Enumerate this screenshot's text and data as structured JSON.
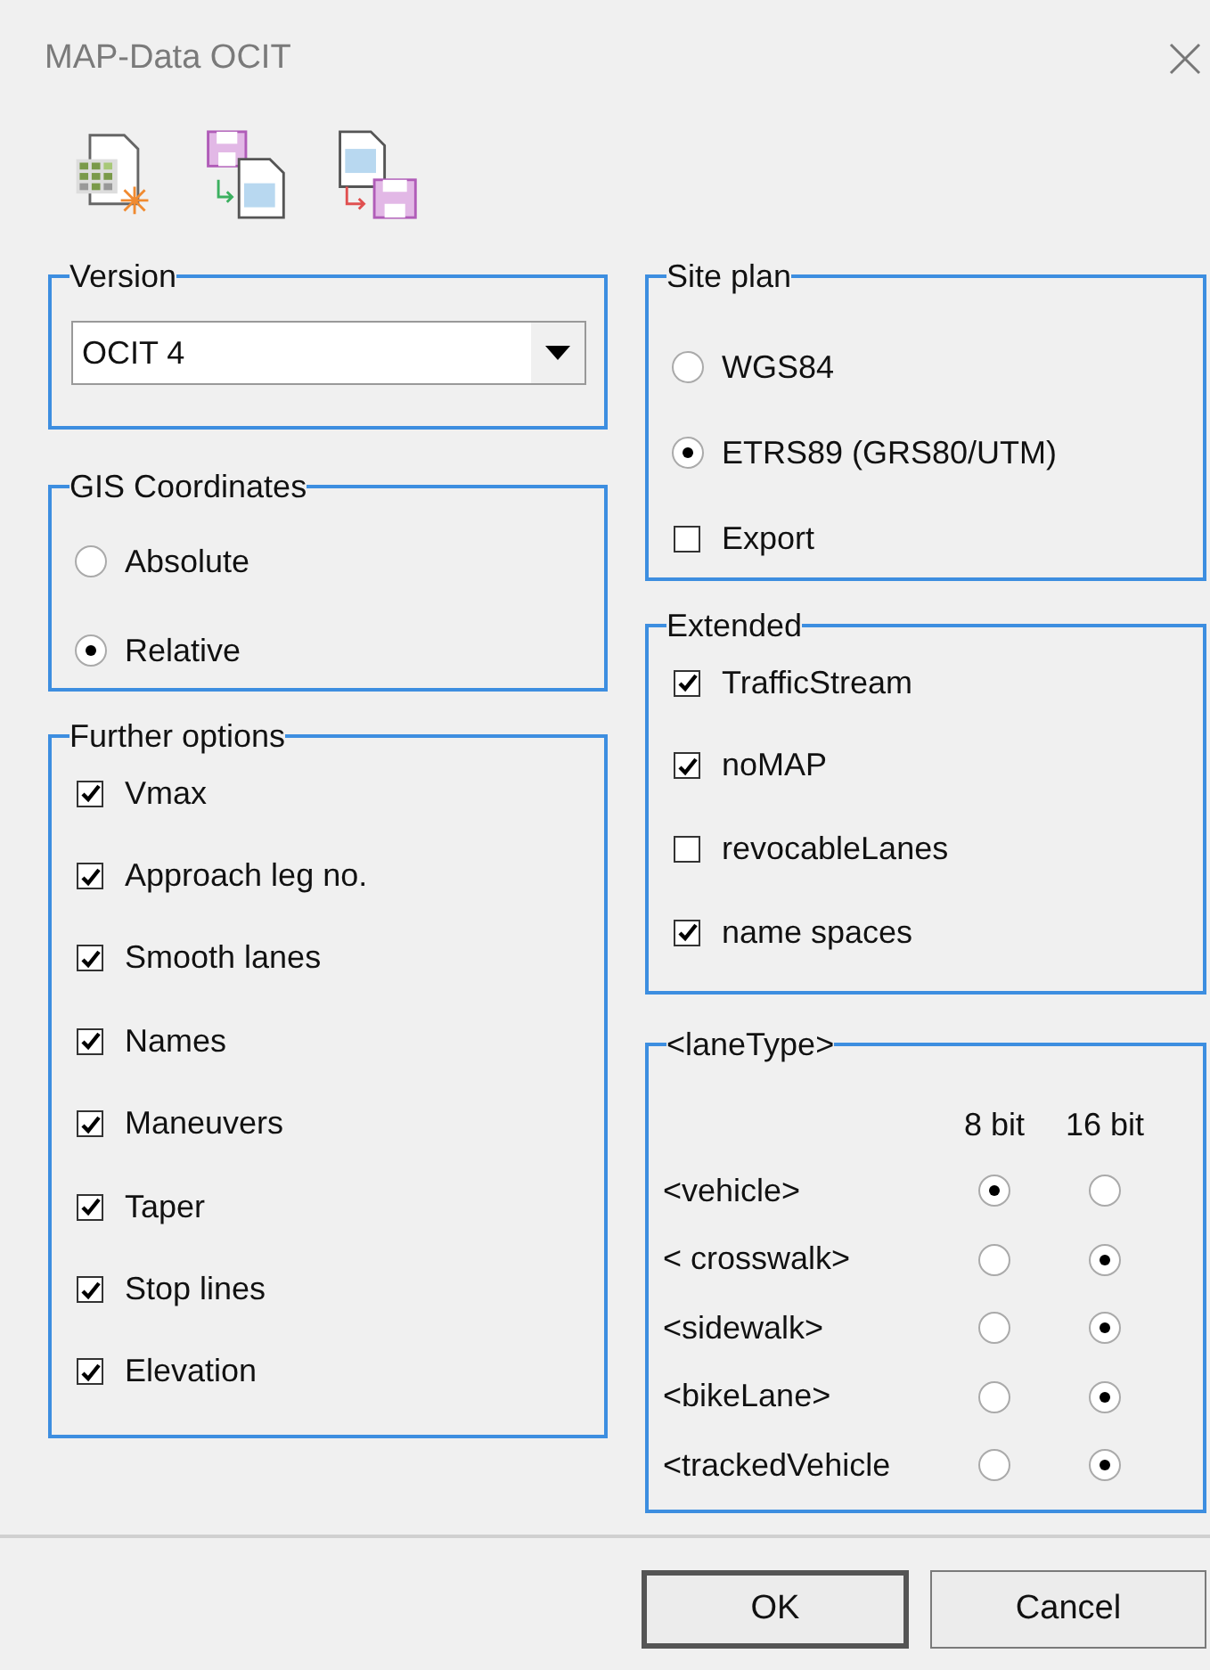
{
  "window": {
    "title": "MAP-Data OCIT"
  },
  "version": {
    "title": "Version",
    "value": "OCIT 4"
  },
  "gis_coordinates": {
    "title": "GIS Coordinates",
    "options": [
      {
        "label": "Absolute",
        "selected": false
      },
      {
        "label": "Relative",
        "selected": true
      }
    ]
  },
  "further_options": {
    "title": "Further options",
    "items": [
      {
        "label": "Vmax",
        "checked": true
      },
      {
        "label": "Approach leg no.",
        "checked": true
      },
      {
        "label": "Smooth lanes",
        "checked": true
      },
      {
        "label": "Names",
        "checked": true
      },
      {
        "label": "Maneuvers",
        "checked": true
      },
      {
        "label": "Taper",
        "checked": true
      },
      {
        "label": "Stop lines",
        "checked": true
      },
      {
        "label": "Elevation",
        "checked": true
      }
    ]
  },
  "site_plan": {
    "title": "Site plan",
    "options": [
      {
        "label": "WGS84",
        "selected": false
      },
      {
        "label": "ETRS89 (GRS80/UTM)",
        "selected": true
      }
    ],
    "export": {
      "label": "Export",
      "checked": false
    }
  },
  "extended": {
    "title": "Extended",
    "items": [
      {
        "label": "TrafficStream",
        "checked": true
      },
      {
        "label": "noMAP",
        "checked": true
      },
      {
        "label": "revocableLanes",
        "checked": false
      },
      {
        "label": "name spaces",
        "checked": true
      }
    ]
  },
  "lane_type": {
    "title": "<laneType>",
    "columns": [
      "8 bit",
      "16 bit"
    ],
    "rows": [
      {
        "label": "<vehicle>",
        "options": [
          {
            "selected": true
          },
          {
            "selected": false
          }
        ]
      },
      {
        "label": "< crosswalk>",
        "options": [
          {
            "selected": false
          },
          {
            "selected": true
          }
        ]
      },
      {
        "label": "<sidewalk>",
        "options": [
          {
            "selected": false
          },
          {
            "selected": true
          }
        ]
      },
      {
        "label": "<bikeLane>",
        "options": [
          {
            "selected": false
          },
          {
            "selected": true
          }
        ]
      },
      {
        "label": "<trackedVehicle",
        "options": [
          {
            "selected": false
          },
          {
            "selected": true
          }
        ]
      }
    ]
  },
  "buttons": [
    {
      "label": "OK",
      "default": true
    },
    {
      "label": "Cancel",
      "default": false
    }
  ]
}
